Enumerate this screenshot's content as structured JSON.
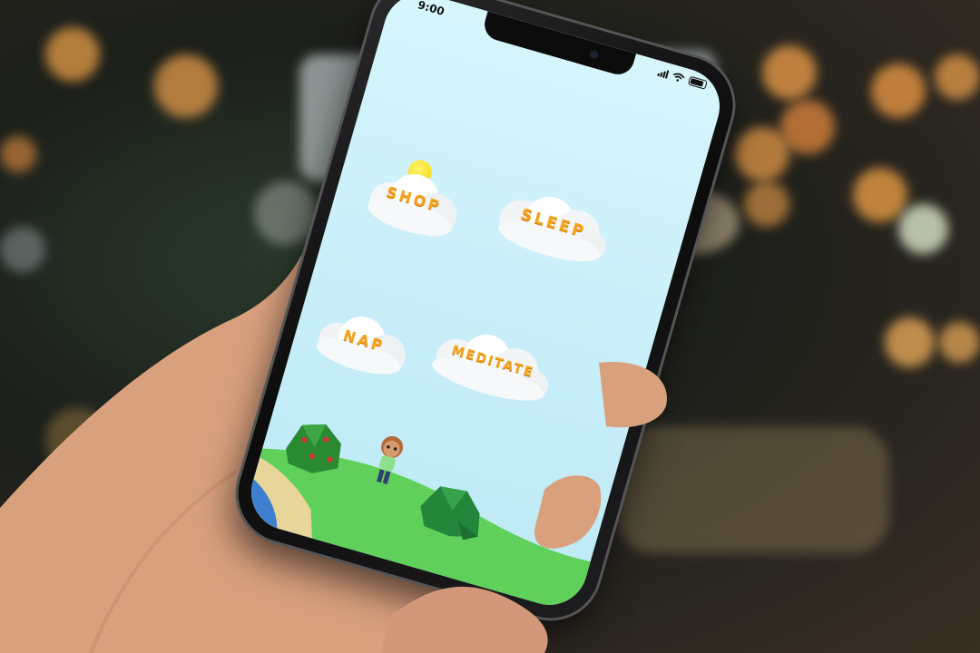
{
  "status_bar": {
    "time": "9:00"
  },
  "menu": {
    "shop": "SHOP",
    "sleep": "SLEEP",
    "nap": "NAP",
    "meditate": "MEDITATE"
  },
  "colors": {
    "sky": "#c7eef8",
    "label": "#f6a21a",
    "grass": "#5fd15a"
  },
  "icons": [
    "sun-icon",
    "character-avatar",
    "bush-icon",
    "wifi-icon",
    "signal-icon",
    "battery-icon"
  ]
}
